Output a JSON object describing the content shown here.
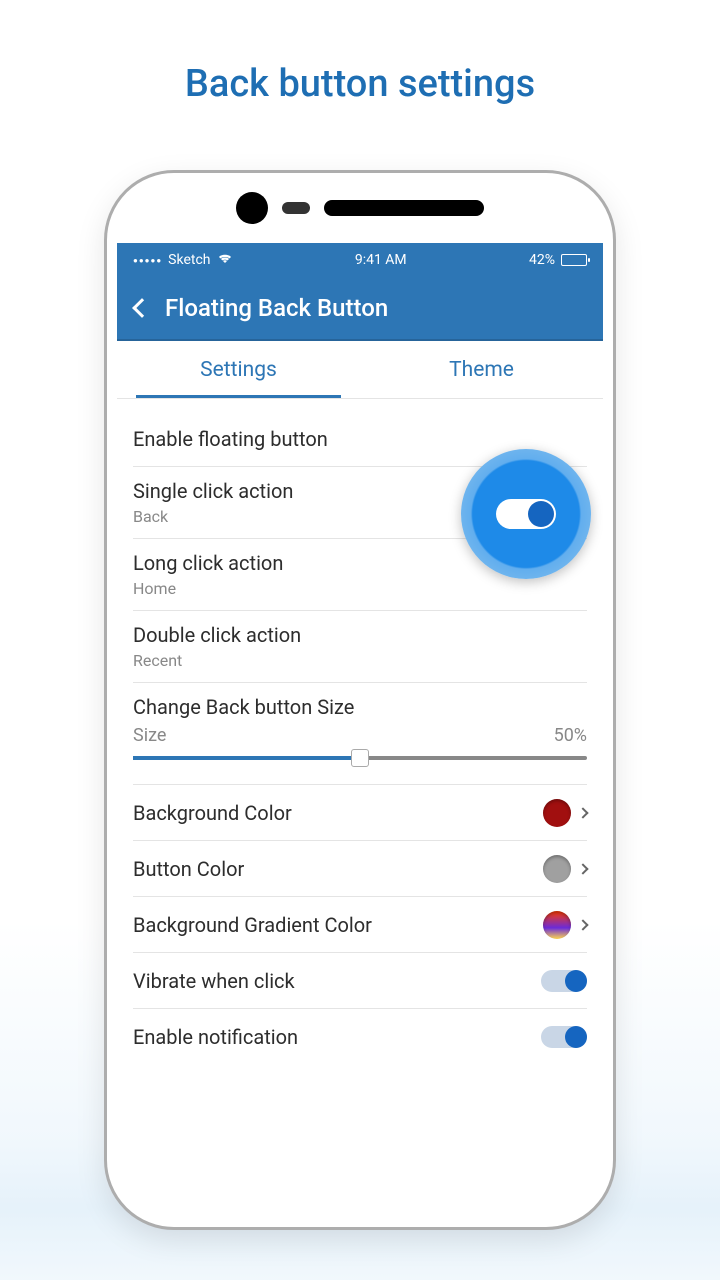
{
  "page": {
    "title": "Back button settings"
  },
  "status": {
    "carrier": "Sketch",
    "time": "9:41 AM",
    "battery_pct": "42%"
  },
  "appbar": {
    "title": "Floating Back Button"
  },
  "tabs": [
    {
      "label": "Settings",
      "active": true
    },
    {
      "label": "Theme",
      "active": false
    }
  ],
  "settings": {
    "enable_floating": {
      "label": "Enable floating button",
      "on": true
    },
    "single_click": {
      "label": "Single click action",
      "value": "Back"
    },
    "long_click": {
      "label": "Long click action",
      "value": "Home"
    },
    "double_click": {
      "label": "Double click action",
      "value": "Recent"
    },
    "size": {
      "label": "Change Back button Size",
      "sub_label": "Size",
      "value_pct": "50%"
    },
    "bg_color": {
      "label": "Background Color",
      "color": "#a10f0f"
    },
    "btn_color": {
      "label": "Button Color",
      "color": "#a0a0a0"
    },
    "bg_gradient": {
      "label": "Background Gradient Color"
    },
    "vibrate": {
      "label": "Vibrate when click",
      "on": true
    },
    "notification": {
      "label": "Enable notification",
      "on": true
    }
  }
}
